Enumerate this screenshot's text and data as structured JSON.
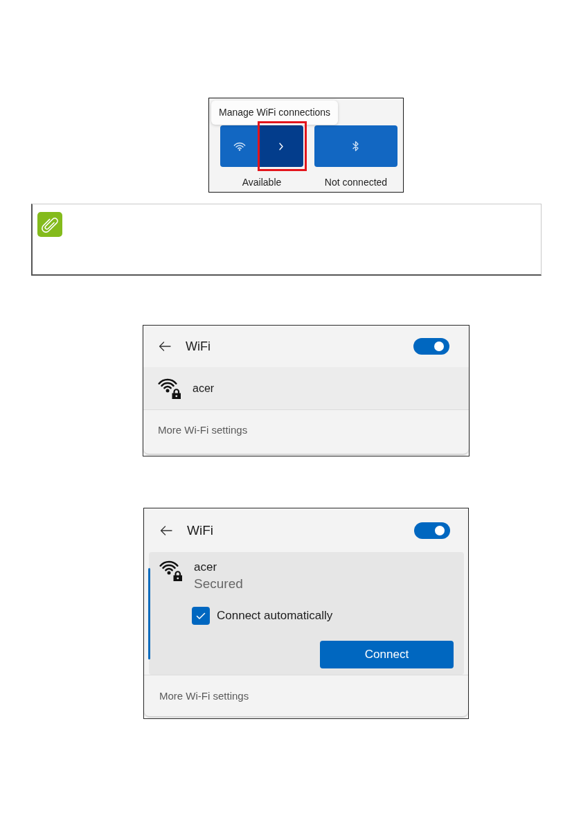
{
  "figures": [
    {
      "kind": "quick_settings",
      "tooltip": "Manage WiFi connections",
      "tiles": [
        {
          "kind": "wifi",
          "label": "Available",
          "callout": true
        },
        {
          "kind": "bluetooth",
          "label": "Not connected",
          "callout": false
        }
      ]
    },
    {
      "kind": "note"
    },
    {
      "kind": "wifi_panel",
      "title": "WiFi",
      "wifi_on": true,
      "networks": [
        {
          "name": "acer",
          "selected": false,
          "expanded": false
        }
      ],
      "footer_link": "More Wi-Fi settings"
    },
    {
      "kind": "wifi_panel",
      "title": "WiFi",
      "wifi_on": true,
      "networks": [
        {
          "name": "acer",
          "selected": true,
          "expanded": true,
          "status": "Secured",
          "auto_connect_label": "Connect automatically",
          "auto_connect": true,
          "button": "Connect"
        }
      ],
      "footer_link": "More Wi-Fi settings"
    }
  ]
}
